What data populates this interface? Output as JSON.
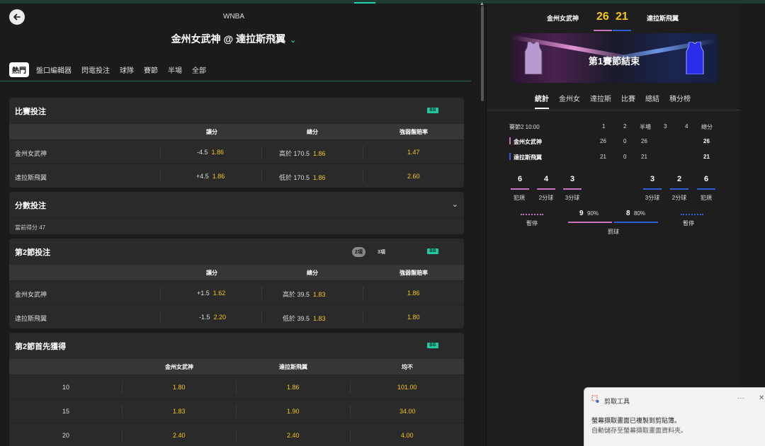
{
  "header": {
    "league": "WNBA",
    "match_title": "金州女武神 @ 達拉斯飛翼"
  },
  "tabs": [
    "熱門",
    "盤口編輯器",
    "閃電投注",
    "球隊",
    "賽節",
    "半場",
    "全部"
  ],
  "badge_label": "BB",
  "markets": {
    "game": {
      "title": "比賽投注",
      "columns": [
        "讓分",
        "總分",
        "強弱盤賠率"
      ],
      "rows": [
        {
          "team": "金州女武神",
          "spread_line": "-4.5",
          "spread_odds": "1.86",
          "total_line": "高於 170.5",
          "total_odds": "1.86",
          "moneyline": "1.47"
        },
        {
          "team": "達拉斯飛翼",
          "spread_line": "+4.5",
          "spread_odds": "1.86",
          "total_line": "低於 170.5",
          "total_odds": "1.86",
          "moneyline": "2.60"
        }
      ]
    },
    "points": {
      "title": "分數投注",
      "current": "當前得分 47"
    },
    "q2": {
      "title": "第2節投注",
      "pill_on": "2項",
      "pill_off": "3項",
      "columns": [
        "讓分",
        "總分",
        "強弱盤賠率"
      ],
      "rows": [
        {
          "team": "金州女武神",
          "spread_line": "+1.5",
          "spread_odds": "1.62",
          "total_line": "高於 39.5",
          "total_odds": "1.83",
          "moneyline": "1.86"
        },
        {
          "team": "達拉斯飛翼",
          "spread_line": "-1.5",
          "spread_odds": "2.20",
          "total_line": "低於 39.5",
          "total_odds": "1.83",
          "moneyline": "1.80"
        }
      ]
    },
    "race": {
      "title": "第2節首先獲得",
      "columns": [
        "金州女武神",
        "達拉斯飛翼",
        "均不"
      ],
      "rows": [
        {
          "pts": "10",
          "a": "1.80",
          "b": "1.86",
          "none": "101.00"
        },
        {
          "pts": "15",
          "a": "1.83",
          "b": "1.90",
          "none": "34.00"
        },
        {
          "pts": "20",
          "a": "2.40",
          "b": "2.40",
          "none": "4.00"
        }
      ]
    }
  },
  "scoreboard": {
    "home": "金州女武神",
    "home_score": "26",
    "away_score": "21",
    "away": "達拉斯飛翼",
    "banner": "第1賽節結束",
    "home_color": "#c872c0",
    "away_color": "#2f5fd8"
  },
  "right_tabs": [
    "統計",
    "金州女",
    "達拉斯",
    "比賽",
    "總結",
    "積分榜"
  ],
  "boxscore": {
    "period": "賽節2 10:00",
    "headers": [
      "1",
      "2",
      "半場",
      "3",
      "4",
      "總分"
    ],
    "rows": [
      {
        "team": "金州女武神",
        "q1": "26",
        "q2": "0",
        "half": "26",
        "total": "26"
      },
      {
        "team": "達拉斯飛翼",
        "q1": "21",
        "q2": "0",
        "half": "21",
        "total": "21"
      }
    ]
  },
  "team_stats": {
    "home": [
      {
        "v": "6",
        "l": "犯規"
      },
      {
        "v": "4",
        "l": "2分球"
      },
      {
        "v": "3",
        "l": "3分球"
      }
    ],
    "away": [
      {
        "v": "3",
        "l": "3分球"
      },
      {
        "v": "2",
        "l": "2分球"
      },
      {
        "v": "6",
        "l": "犯規"
      }
    ],
    "timeout_label": "暫停",
    "ft_label": "罰球",
    "home_ft": "9",
    "home_ft_pct": "90%",
    "away_ft": "8",
    "away_ft_pct": "80%"
  },
  "toast": {
    "app": "剪取工具",
    "more": "···",
    "close": "✕",
    "line1": "螢幕擷取畫面已複製到剪貼簿。",
    "line2": "自動儲存至螢幕擷取畫面資料夾。"
  }
}
